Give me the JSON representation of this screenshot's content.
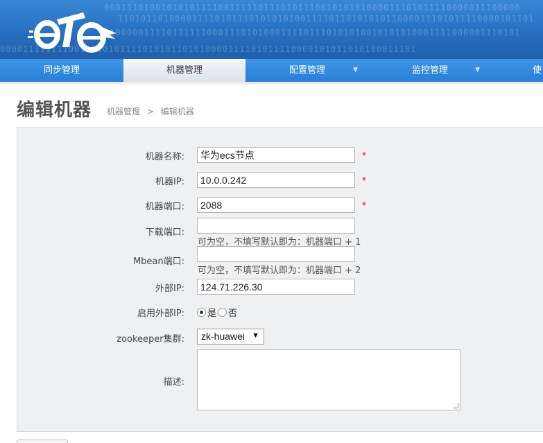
{
  "header": {
    "binary_lines": [
      "0001110100101010111100111110111010111001010101000011101011110000011100000",
      "1101011010000111101011101010101001111011010101011000011101011110000101101",
      "0100000111101111110001110101000111101110101010010101010001111000001110101",
      "0000111111110011110101111010101101010000111101011110000101011010100011101"
    ],
    "logo_text": "eTe"
  },
  "nav": {
    "items": [
      {
        "label": "同步管理",
        "active": false,
        "dropdown": false
      },
      {
        "label": "机器管理",
        "active": true,
        "dropdown": false
      },
      {
        "label": "配置管理",
        "active": false,
        "dropdown": true
      },
      {
        "label": "监控管理",
        "active": false,
        "dropdown": true
      },
      {
        "label": "使",
        "active": false,
        "dropdown": false
      }
    ],
    "caret": "▼"
  },
  "page": {
    "title": "编辑机器",
    "breadcrumb": [
      "机器管理",
      "编辑机器"
    ],
    "breadcrumb_sep": ">"
  },
  "form": {
    "name_label": "机器名称:",
    "name_value": "华为ecs节点",
    "ip_label": "机器IP:",
    "ip_value": "10.0.0.242",
    "port_label": "机器端口:",
    "port_value": "2088",
    "download_port_label": "下载端口:",
    "download_port_value": "",
    "download_port_hint": "可为空，不填写默认即为：机器端口 + 1",
    "mbean_port_label": "Mbean端口:",
    "mbean_port_value": "",
    "mbean_port_hint": "可为空，不填写默认即为：机器端口 + 2",
    "external_ip_label": "外部IP:",
    "external_ip_value": "124.71.226.30",
    "use_external_ip_label": "启用外部IP:",
    "use_external_ip_yes": "是",
    "use_external_ip_no": "否",
    "use_external_ip_selected": "yes",
    "zookeeper_label": "zookeeper集群:",
    "zookeeper_value": "zk-huawei",
    "description_label": "描述:",
    "description_value": "",
    "required_mark": "*"
  },
  "colors": {
    "banner": "#2b73c4",
    "nav": "#2a7fd4",
    "required": "#d0021b"
  }
}
